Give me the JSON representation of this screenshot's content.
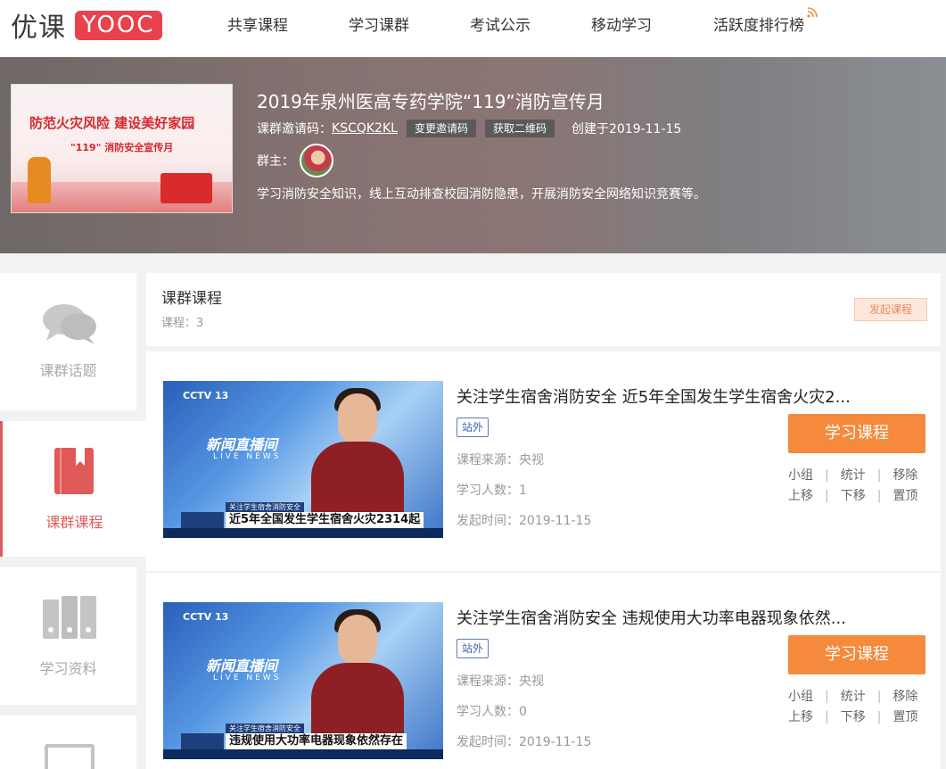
{
  "logo": {
    "cn": "优课",
    "en": "YOOC"
  },
  "nav": [
    "共享课程",
    "学习课群",
    "考试公示",
    "移动学习",
    "活跃度排行榜"
  ],
  "hero": {
    "cover_title": "防范火灾风险 建设美好家园",
    "cover_sub": "\"119\" 消防安全宣传月",
    "title": "2019年泉州医高专药学院“119”消防宣传月",
    "invite_label": "课群邀请码：",
    "invite_code": "KSCQK2KL",
    "change_code": "变更邀请码",
    "get_qr": "获取二维码",
    "created": "创建于2019-11-15",
    "owner_label": "群主：",
    "description": "学习消防安全知识，线上互动排查校园消防隐患，开展消防安全网络知识竞赛等。"
  },
  "sidebar": [
    {
      "label": "课群话题",
      "icon": "chat-icon",
      "active": false
    },
    {
      "label": "课群课程",
      "icon": "book-icon",
      "active": true
    },
    {
      "label": "学习资料",
      "icon": "binder-icon",
      "active": false
    }
  ],
  "main": {
    "title": "课群课程",
    "count": "课程：3",
    "launch": "发起课程"
  },
  "courses": [
    {
      "title": "关注学生宿舍消防安全 近5年全国发生学生宿舍火灾2...",
      "badge": "站外",
      "source": "课程来源：央视",
      "learners": "学习人数：1",
      "date": "发起时间：2019-11-15",
      "study": "学习课程",
      "thumb": {
        "channel": "CCTV 13",
        "show": "新闻直播间",
        "show_en": "LIVE NEWS",
        "cap_top": "关注学生宿舍消防安全",
        "caption": "近5年全国发生学生宿舍火灾2314起"
      }
    },
    {
      "title": "关注学生宿舍消防安全 违规使用大功率电器现象依然...",
      "badge": "站外",
      "source": "课程来源：央视",
      "learners": "学习人数：0",
      "date": "发起时间：2019-11-15",
      "study": "学习课程",
      "thumb": {
        "channel": "CCTV 13",
        "show": "新闻直播间",
        "show_en": "LIVE NEWS",
        "cap_top": "关注学生宿舍消防安全",
        "caption": "违规使用大功率电器现象依然存在"
      }
    }
  ],
  "ops": {
    "group": "小组",
    "stats": "统计",
    "remove": "移除",
    "up": "上移",
    "down": "下移",
    "top": "置顶"
  },
  "colors": {
    "accent_orange": "#f58a3c",
    "active_red": "#e05a5a",
    "logo_red": "#e8424d"
  }
}
